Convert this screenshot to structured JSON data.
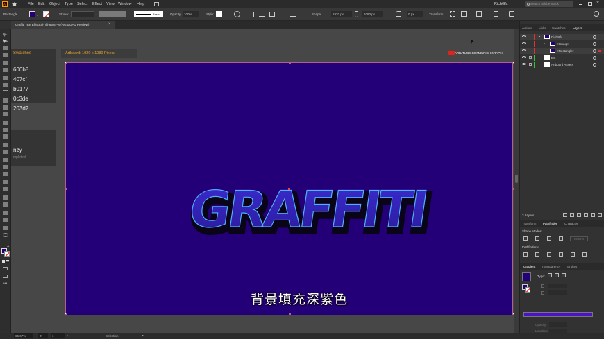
{
  "app": {
    "logo": "Ai",
    "menu": [
      "File",
      "Edit",
      "Object",
      "Type",
      "Select",
      "Effect",
      "View",
      "Window",
      "Help"
    ],
    "workspace": "RichGfx",
    "search_placeholder": "Search Adobe Stock"
  },
  "control_bar": {
    "object_type": "Rectangle",
    "stroke_label": "Stroke:",
    "basic_label": "Basic",
    "opacity_label": "Opacity:",
    "opacity_value": "100%",
    "style_label": "Style:",
    "shape_label": "Shape:",
    "width_value": "1920 px",
    "height_value": "1080 px",
    "x_value": "0 px",
    "transform_label": "Transform"
  },
  "document": {
    "tab_title": "Graffiti Text Effect.ai* @ 66.67% (RGB/GPU Preview)",
    "artboard_label": "Artboard: 1920 x 1080 Pixels",
    "youtube_text": "YOUTUBE.COM/C/RICHGRAPHI",
    "artwork_text": "GRAFFITI",
    "subtitle": "背景填充深紫色",
    "artboard_color": "#240078"
  },
  "swatches_panel": {
    "title": "Swatches",
    "codes": [
      "600b8",
      "407cf",
      "b0177",
      "0c3de",
      "203d2"
    ],
    "lazy_label": "nzy",
    "lazy_sub": "mpleted"
  },
  "layers_panel": {
    "tabs": [
      "Actions",
      "Links",
      "Swatches",
      "Layers"
    ],
    "active_tab": "Layers",
    "rows": [
      {
        "name": "RichGfx"
      },
      {
        "name": "<Group>"
      },
      {
        "name": "<Rectangle>"
      },
      {
        "name": "BG"
      },
      {
        "name": "Artboard Assets"
      }
    ],
    "footer": "3 Layers"
  },
  "pathfinder_panel": {
    "tabs": [
      "Transform",
      "Pathfinder",
      "Character"
    ],
    "active_tab": "Pathfinder",
    "shape_modes": "Shape Modes:",
    "pathfinders": "Pathfinders:",
    "expand": "Expand"
  },
  "gradient_panel": {
    "tabs": [
      "Gradient",
      "Transparency",
      "Strokes"
    ],
    "active_tab": "Gradient",
    "type_label": "Type:",
    "opacity_label": "Opacity:",
    "location_label": "Location:",
    "gradient_color": "#4a13c9"
  },
  "status_bar": {
    "zoom": "66.67%",
    "rotation": "0°",
    "artboard_num": "1",
    "tool": "Selection"
  }
}
